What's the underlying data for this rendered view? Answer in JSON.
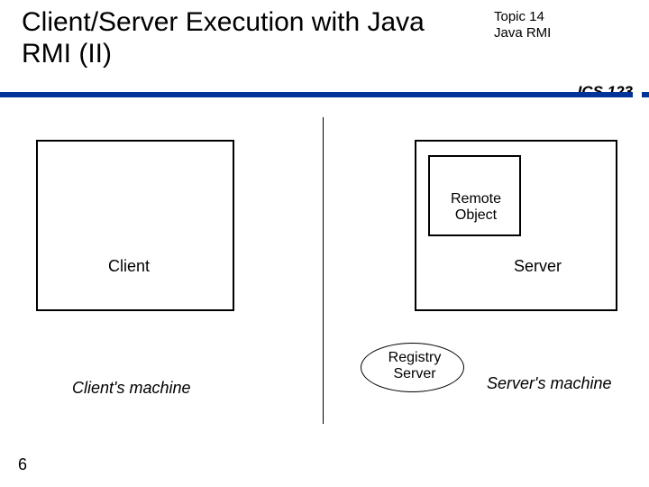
{
  "header": {
    "title": "Client/Server Execution with Java RMI (II)",
    "topic_line1": "Topic 14",
    "topic_line2": "Java RMI",
    "course": "ICS 123"
  },
  "diagram": {
    "client_label": "Client",
    "server_label": "Server",
    "remote_object_label": "Remote Object",
    "registry_label": "Registry Server",
    "client_machine": "Client's machine",
    "server_machine": "Server's machine"
  },
  "page_number": "6"
}
